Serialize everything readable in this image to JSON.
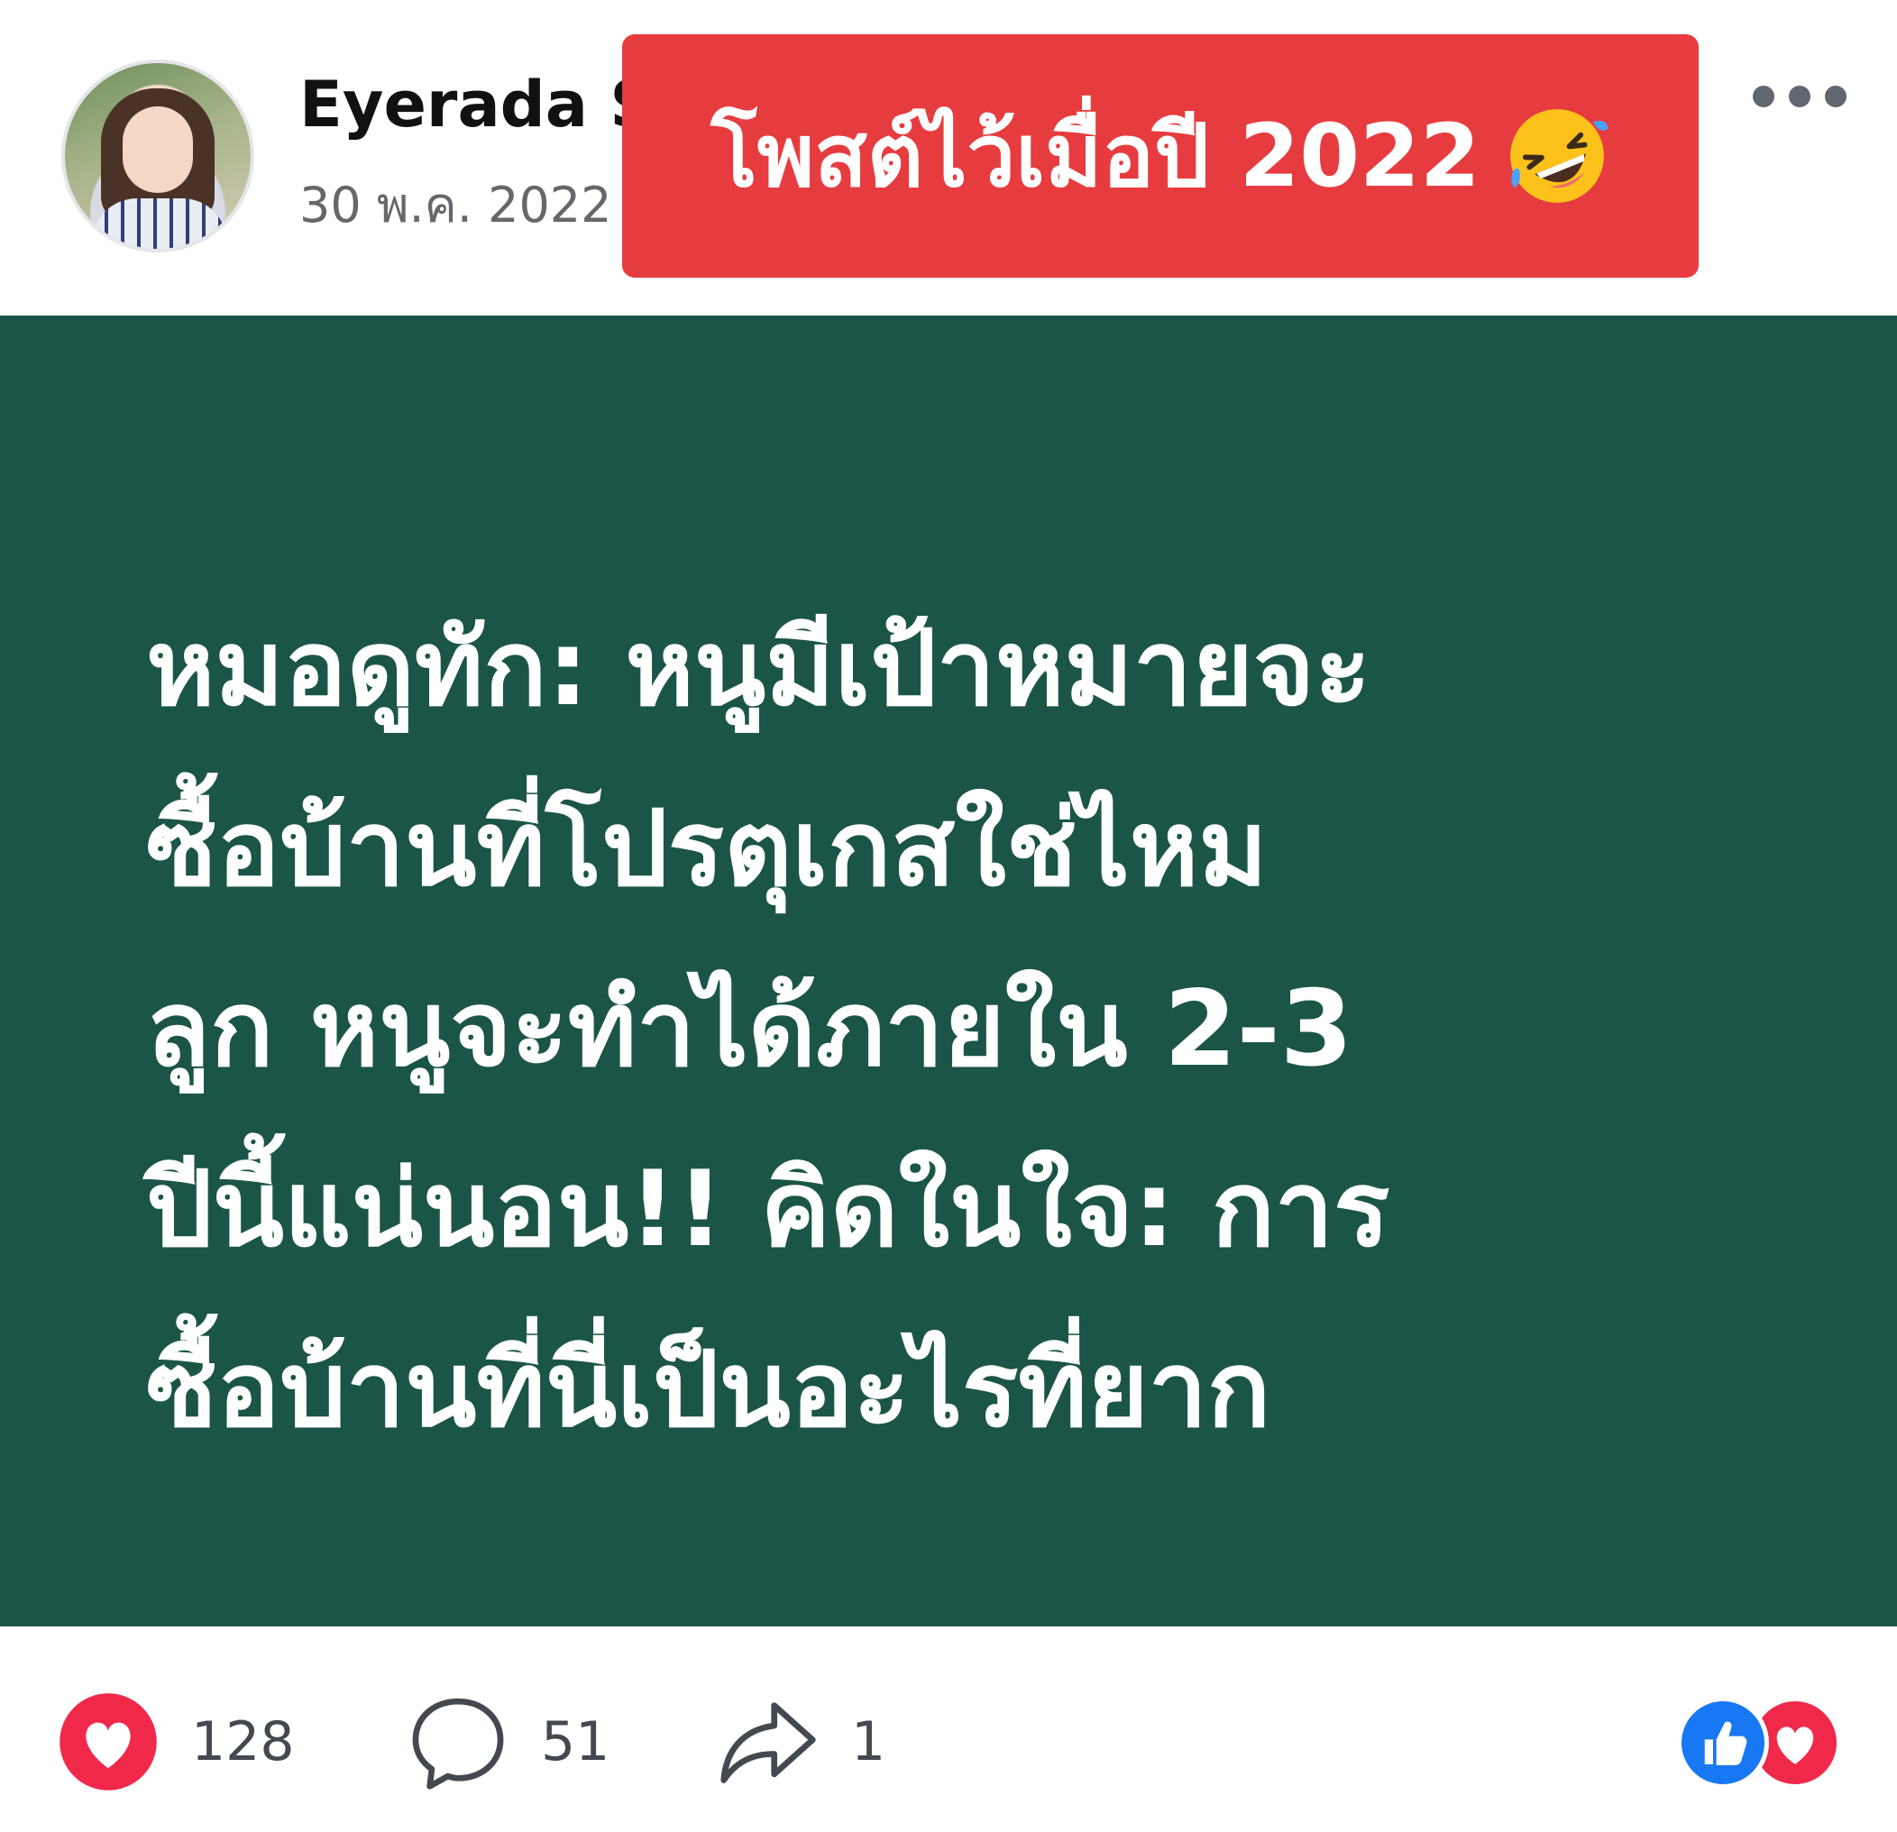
{
  "post": {
    "author_name": "Eyerada S",
    "date": "30 พ.ค. 2022",
    "overlay_banner": "โพสต์ไว้เมื่อปี 2022",
    "body_lines": [
      "หมอดูทัก: หนูมีเป้าหมายจะ",
      "ซื้อบ้านที่โปรตุเกสใช่ไหม",
      "ลูก หนูจะทำได้ภายใน 2-3",
      "ปีนี้แน่นอน!! คิดในใจ: การ",
      "ซื้อบ้านที่นี่เป็นอะไรที่ยาก"
    ]
  },
  "stats": {
    "likes": "128",
    "comments": "51",
    "shares": "1"
  },
  "icons": {
    "banner_emoji": "rolling-on-floor-laughing-emoji",
    "more": "more-dots-icon",
    "like": "heart-icon",
    "comment": "comment-bubble-icon",
    "share": "share-arrow-icon",
    "reaction_1": "like-thumb-icon",
    "reaction_2": "love-heart-icon"
  },
  "colors": {
    "banner_background": "#e73c3f",
    "post_background": "#1b5548",
    "heart_red": "#f0284a",
    "like_blue": "#1877f2"
  }
}
